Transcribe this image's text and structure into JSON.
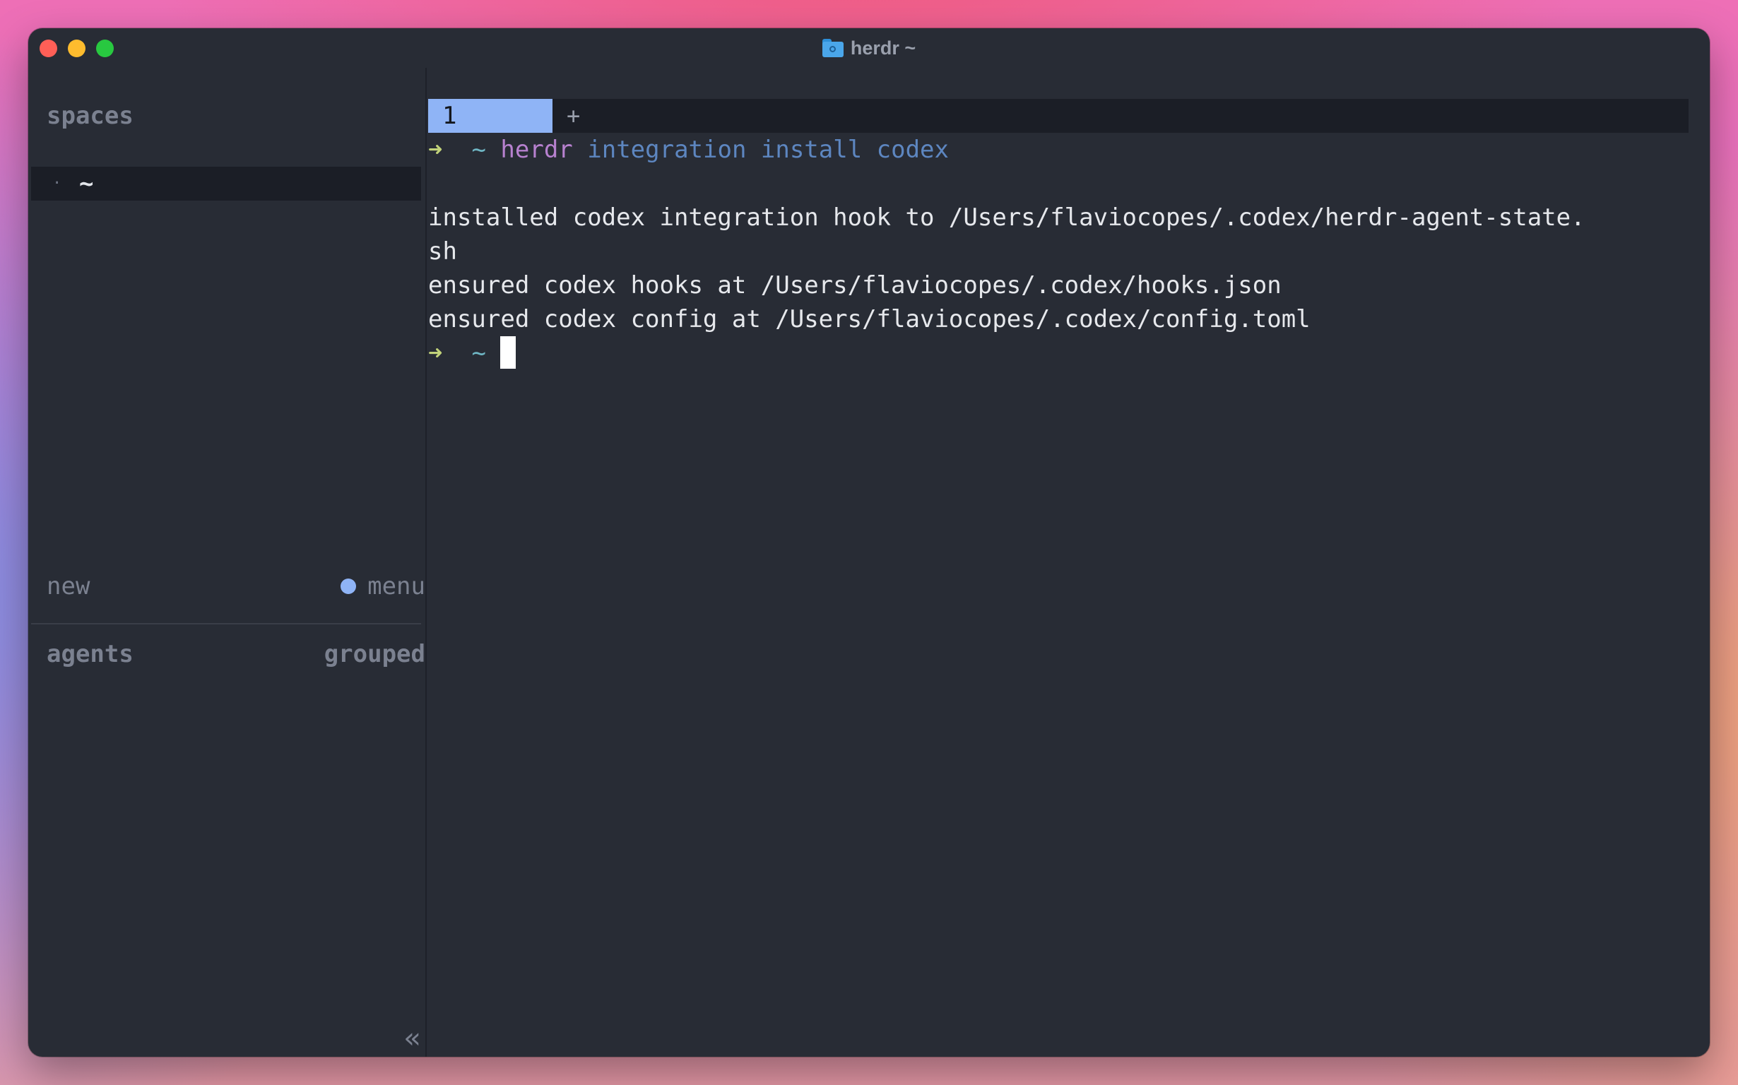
{
  "window": {
    "title": "herdr ~"
  },
  "sidebar": {
    "spaces_header": "spaces",
    "space_items": [
      {
        "bullet": "·",
        "name": "~"
      }
    ],
    "new_label": "new",
    "menu_label": "menu",
    "agents_label": "agents",
    "grouped_label": "grouped",
    "collapse_glyph": "«"
  },
  "tabs": {
    "active_label": "1",
    "add_label": "+"
  },
  "terminal": {
    "prompt_arrow": "➜",
    "prompt_dir": "~",
    "command_name": "herdr",
    "command_args": "integration install codex",
    "output_lines": [
      "installed codex integration hook to /Users/flaviocopes/.codex/herdr-agent-state.",
      "sh",
      "ensured codex hooks at /Users/flaviocopes/.codex/hooks.json",
      "ensured codex config at /Users/flaviocopes/.codex/config.toml"
    ]
  },
  "colors": {
    "window_bg": "#282c35",
    "accent": "#8fb4f6",
    "prompt_arrow": "#c2d37a",
    "prompt_dir": "#6fb6c4",
    "command_name": "#b781cf",
    "command_args": "#5d86c0"
  },
  "icons": {
    "title": "folder-icon",
    "collapse": "double-chevron-left-icon",
    "close": "close-window-icon",
    "minimize": "minimize-window-icon",
    "maximize": "maximize-window-icon"
  }
}
